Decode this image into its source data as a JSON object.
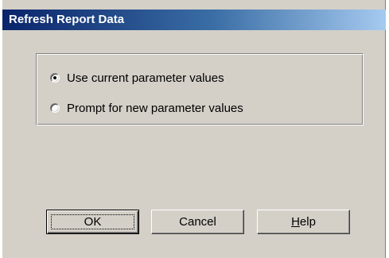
{
  "dialog": {
    "title": "Refresh Report Data"
  },
  "options": [
    {
      "label": "Use current parameter values",
      "selected": true
    },
    {
      "label": "Prompt for new parameter values",
      "selected": false
    }
  ],
  "buttons": {
    "ok": "OK",
    "cancel": "Cancel",
    "help_mnemonic": "H",
    "help_rest": "elp"
  }
}
